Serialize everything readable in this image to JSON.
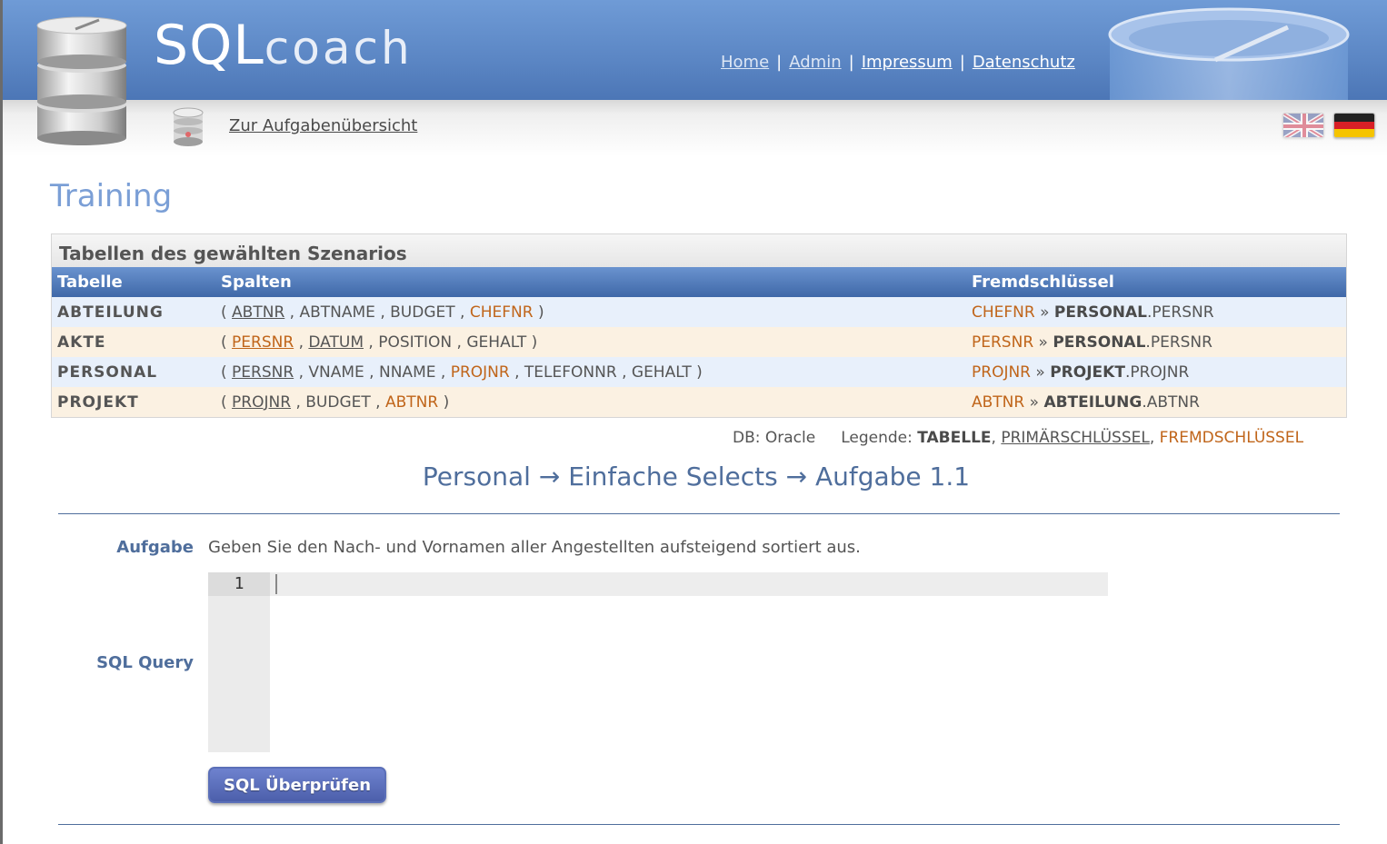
{
  "header": {
    "logo_sq": "SQL",
    "logo_coach": "coach",
    "nav": [
      "Home",
      "Admin",
      "Impressum",
      "Datenschutz"
    ],
    "nav_sep": "|"
  },
  "subbar": {
    "back_link": "Zur Aufgabenübersicht",
    "languages": [
      "uk-flag-icon",
      "de-flag-icon"
    ]
  },
  "page": {
    "title": "Training"
  },
  "scenario": {
    "heading": "Tabellen des gewählten Szenarios",
    "columns": [
      "Tabelle",
      "Spalten",
      "Fremdschlüssel"
    ],
    "rows": [
      {
        "table": "ABTEILUNG",
        "cols": [
          {
            "name": "ABTNR",
            "pk": true,
            "fk": false
          },
          {
            "name": "ABTNAME",
            "pk": false,
            "fk": false
          },
          {
            "name": "BUDGET",
            "pk": false,
            "fk": false
          },
          {
            "name": "CHEFNR",
            "pk": false,
            "fk": true
          }
        ],
        "fk": {
          "col": "CHEFNR",
          "ref_table": "PERSONAL",
          "ref_col": "PERSNR"
        }
      },
      {
        "table": "AKTE",
        "cols": [
          {
            "name": "PERSNR",
            "pk": true,
            "fk": true
          },
          {
            "name": "DATUM",
            "pk": true,
            "fk": false
          },
          {
            "name": "POSITION",
            "pk": false,
            "fk": false
          },
          {
            "name": "GEHALT",
            "pk": false,
            "fk": false
          }
        ],
        "fk": {
          "col": "PERSNR",
          "ref_table": "PERSONAL",
          "ref_col": "PERSNR"
        }
      },
      {
        "table": "PERSONAL",
        "cols": [
          {
            "name": "PERSNR",
            "pk": true,
            "fk": false
          },
          {
            "name": "VNAME",
            "pk": false,
            "fk": false
          },
          {
            "name": "NNAME",
            "pk": false,
            "fk": false
          },
          {
            "name": "PROJNR",
            "pk": false,
            "fk": true
          },
          {
            "name": "TELEFONNR",
            "pk": false,
            "fk": false
          },
          {
            "name": "GEHALT",
            "pk": false,
            "fk": false
          }
        ],
        "fk": {
          "col": "PROJNR",
          "ref_table": "PROJEKT",
          "ref_col": "PROJNR"
        }
      },
      {
        "table": "PROJEKT",
        "cols": [
          {
            "name": "PROJNR",
            "pk": true,
            "fk": false
          },
          {
            "name": "BUDGET",
            "pk": false,
            "fk": false
          },
          {
            "name": "ABTNR",
            "pk": false,
            "fk": true
          }
        ],
        "fk": {
          "col": "ABTNR",
          "ref_table": "ABTEILUNG",
          "ref_col": "ABTNR"
        }
      }
    ]
  },
  "legend": {
    "db": "DB: Oracle",
    "label": "Legende:",
    "table": "TABELLE",
    "pk": "PRIMÄRSCHLÜSSEL",
    "fk": "FREMDSCHLÜSSEL"
  },
  "breadcrumb": "Personal → Einfache Selects → Aufgabe 1.1",
  "task": {
    "label": "Aufgabe",
    "text": "Geben Sie den Nach- und Vornamen aller Angestellten aufsteigend sortiert aus."
  },
  "query": {
    "label": "SQL Query",
    "line_number": "1",
    "value": ""
  },
  "submit_label": "SQL Überprüfen",
  "colors": {
    "header_blue": "#5b86c4",
    "fk_orange": "#c0651a",
    "title_blue": "#7b9fd6",
    "accent_blue": "#4f6e9c",
    "button_blue": "#5a6dbd"
  }
}
